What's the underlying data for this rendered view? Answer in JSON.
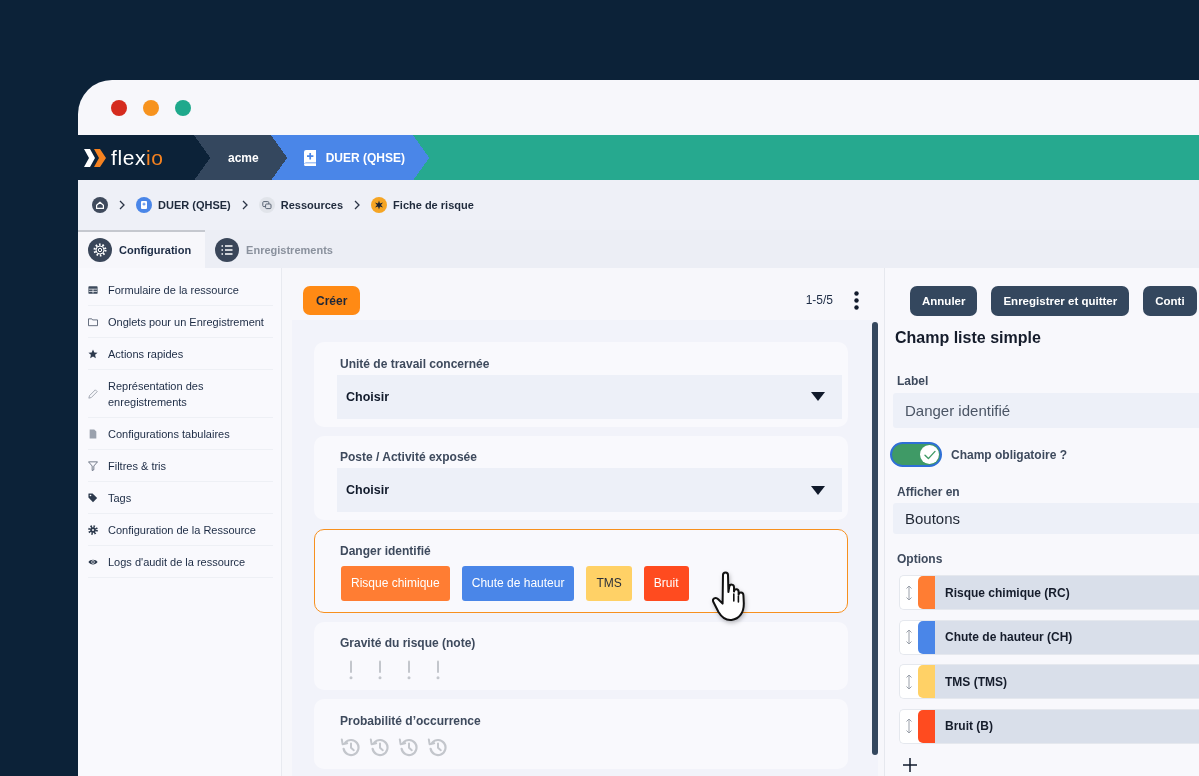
{
  "window": {
    "controls": [
      {
        "color": "#d52b1e"
      },
      {
        "color": "#f7931e"
      },
      {
        "color": "#1fa98c"
      }
    ]
  },
  "app_bar": {
    "logo": {
      "text": "flex",
      "accent": "io"
    },
    "segments": [
      {
        "label": "acme",
        "kind": "workspace",
        "color": "#34475e"
      },
      {
        "label": "DUER (QHSE)",
        "kind": "app",
        "color": "#4a86e8"
      }
    ]
  },
  "breadcrumb": [
    {
      "label": "DUER (QHSE)",
      "kind": "app"
    },
    {
      "label": "Ressources",
      "kind": "resources"
    },
    {
      "label": "Fiche de risque",
      "kind": "record"
    }
  ],
  "tabs": [
    {
      "label": "Configuration",
      "kind": "settings",
      "selected": true
    },
    {
      "label": "Enregistrements",
      "kind": "records",
      "selected": false
    }
  ],
  "sidebar": {
    "items": [
      {
        "label": "Formulaire de la ressource",
        "kind": "form"
      },
      {
        "label": "Onglets pour un Enregistrement",
        "kind": "tabs"
      },
      {
        "label": "Actions rapides",
        "kind": "actions"
      },
      {
        "label": "Représentation des enregistrements",
        "kind": "display"
      },
      {
        "label": "Configurations tabulaires",
        "kind": "tables"
      },
      {
        "label": "Filtres & tris",
        "kind": "filters"
      },
      {
        "label": "Tags",
        "kind": "tags"
      },
      {
        "label": "Configuration de la Ressource",
        "kind": "settings"
      },
      {
        "label": "Logs d'audit de la ressource",
        "kind": "logs"
      }
    ]
  },
  "list_toolbar": {
    "create_button": "Créer",
    "pagination": "1-5/5"
  },
  "form_fields": [
    {
      "label": "Unité de travail concernée",
      "kind": "select",
      "value": "Choisir",
      "selected": false
    },
    {
      "label": "Poste / Activité exposée",
      "kind": "select",
      "value": "Choisir",
      "selected": false
    },
    {
      "label": "Danger identifié",
      "kind": "buttons",
      "selected": true,
      "options": [
        {
          "label": "Risque chimique",
          "color": "#ff7d33"
        },
        {
          "label": "Chute de hauteur",
          "color": "#4a86e8"
        },
        {
          "label": "TMS",
          "color": "#ffd166"
        },
        {
          "label": "Bruit",
          "color": "#ff4b1f"
        }
      ]
    },
    {
      "label": "Gravité du risque (note)",
      "kind": "severity_rating",
      "selected": false
    },
    {
      "label": "Probabilité d’occurrence",
      "kind": "frequency_rating",
      "stars": 0,
      "selected": false
    }
  ],
  "editor": {
    "actions": [
      "Annuler",
      "Enregistrer et quitter",
      "Conti"
    ],
    "title": "Champ liste simple",
    "fields": [
      {
        "kind": "text",
        "label": "Label",
        "value": "Danger identifié"
      },
      {
        "kind": "toggle",
        "label": "Champ obligatoire ?",
        "on": true
      },
      {
        "kind": "select",
        "label": "Afficher en",
        "value": "Boutons"
      }
    ],
    "options": {
      "label": "Options",
      "items": [
        {
          "label": "Risque chimique (RC)",
          "color": "#ff7d33"
        },
        {
          "label": "Chute de hauteur (CH)",
          "color": "#4a86e8"
        },
        {
          "label": "TMS (TMS)",
          "color": "#ffd166"
        },
        {
          "label": "Bruit (B)",
          "color": "#ff4b1f"
        }
      ]
    }
  }
}
